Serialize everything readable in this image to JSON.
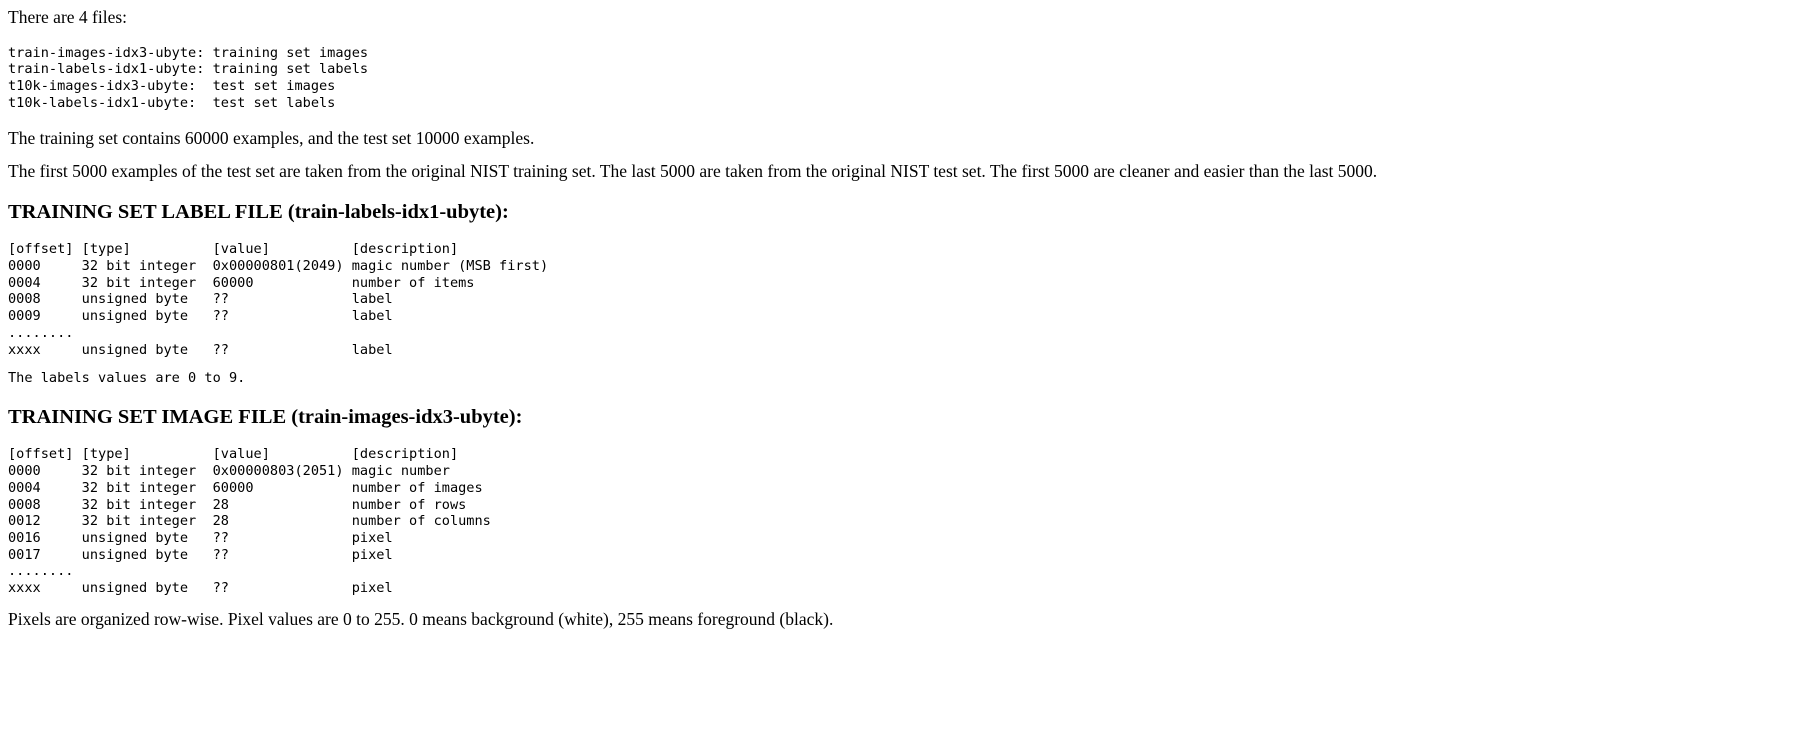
{
  "document": {
    "intro_line": "There are 4 files:",
    "file_list": "train-images-idx3-ubyte: training set images\ntrain-labels-idx1-ubyte: training set labels\nt10k-images-idx3-ubyte:  test set images\nt10k-labels-idx1-ubyte:  test set labels",
    "files": [
      {
        "name": "train-images-idx3-ubyte:",
        "description": "training set images"
      },
      {
        "name": "train-labels-idx1-ubyte:",
        "description": "training set labels"
      },
      {
        "name": "t10k-images-idx3-ubyte:",
        "description": "test set images"
      },
      {
        "name": "t10k-labels-idx1-ubyte:",
        "description": "test set labels"
      }
    ],
    "counts_paragraph": "The training set contains 60000 examples, and the test set 10000 examples.",
    "nist_paragraph": "The first 5000 examples of the test set are taken from the original NIST training set. The last 5000 are taken from the original NIST test set. The first 5000 are cleaner and easier than the last 5000.",
    "label_file": {
      "heading": "TRAINING SET LABEL FILE (train-labels-idx1-ubyte):",
      "columns": [
        "[offset]",
        "[type]",
        "[value]",
        "[description]"
      ],
      "rows": [
        {
          "offset": "0000",
          "type": "32 bit integer",
          "value": "0x00000801(2049)",
          "description": "magic number (MSB first)"
        },
        {
          "offset": "0004",
          "type": "32 bit integer",
          "value": "60000",
          "description": "number of items"
        },
        {
          "offset": "0008",
          "type": "unsigned byte",
          "value": "??",
          "description": "label"
        },
        {
          "offset": "0009",
          "type": "unsigned byte",
          "value": "??",
          "description": "label"
        },
        {
          "offset": "........",
          "type": "",
          "value": "",
          "description": ""
        },
        {
          "offset": "xxxx",
          "type": "unsigned byte",
          "value": "??",
          "description": "label"
        }
      ],
      "table_text": "[offset] [type]          [value]          [description]\n0000     32 bit integer  0x00000801(2049) magic number (MSB first)\n0004     32 bit integer  60000            number of items\n0008     unsigned byte   ??               label\n0009     unsigned byte   ??               label\n........\nxxxx     unsigned byte   ??               label",
      "note": "The labels values are 0 to 9."
    },
    "image_file": {
      "heading": "TRAINING SET IMAGE FILE (train-images-idx3-ubyte):",
      "columns": [
        "[offset]",
        "[type]",
        "[value]",
        "[description]"
      ],
      "rows": [
        {
          "offset": "0000",
          "type": "32 bit integer",
          "value": "0x00000803(2051)",
          "description": "magic number"
        },
        {
          "offset": "0004",
          "type": "32 bit integer",
          "value": "60000",
          "description": "number of images"
        },
        {
          "offset": "0008",
          "type": "32 bit integer",
          "value": "28",
          "description": "number of rows"
        },
        {
          "offset": "0012",
          "type": "32 bit integer",
          "value": "28",
          "description": "number of columns"
        },
        {
          "offset": "0016",
          "type": "unsigned byte",
          "value": "??",
          "description": "pixel"
        },
        {
          "offset": "0017",
          "type": "unsigned byte",
          "value": "??",
          "description": "pixel"
        },
        {
          "offset": "........",
          "type": "",
          "value": "",
          "description": ""
        },
        {
          "offset": "xxxx",
          "type": "unsigned byte",
          "value": "??",
          "description": "pixel"
        }
      ],
      "table_text": "[offset] [type]          [value]          [description]\n0000     32 bit integer  0x00000803(2051) magic number\n0004     32 bit integer  60000            number of images\n0008     32 bit integer  28               number of rows\n0012     32 bit integer  28               number of columns\n0016     unsigned byte   ??               pixel\n0017     unsigned byte   ??               pixel\n........\nxxxx     unsigned byte   ??               pixel"
    },
    "pixels_paragraph": "Pixels are organized row-wise. Pixel values are 0 to 255. 0 means background (white), 255 means foreground (black)."
  },
  "colors": {
    "text": "#000000",
    "background": "#ffffff"
  }
}
